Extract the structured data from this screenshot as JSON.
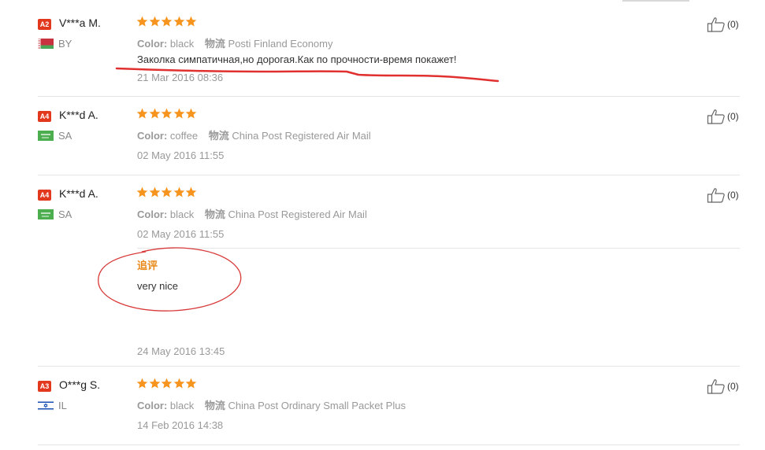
{
  "colors": {
    "badge": "#e2381e",
    "star": "#f7941e",
    "append_label": "#e8891a",
    "annotation": "#e03030"
  },
  "feedback": [
    {
      "level": "A2",
      "buyer": "V***a M.",
      "country": "BY",
      "flag_icon": "belarus-flag",
      "stars": 5,
      "color_label": "Color:",
      "color_value": "black",
      "shipping_label": "物流",
      "shipping_value": "Posti Finland Economy",
      "comment": "Заколка симпатичная,но дорогая.Как по прочности-время покажет!",
      "date": "21 Mar 2016 08:36",
      "helpful": "(0)"
    },
    {
      "level": "A4",
      "buyer": "K***d A.",
      "country": "SA",
      "flag_icon": "saudi-arabia-flag",
      "stars": 5,
      "color_label": "Color:",
      "color_value": "coffee",
      "shipping_label": "物流",
      "shipping_value": "China Post Registered Air Mail",
      "date": "02 May 2016 11:55",
      "helpful": "(0)"
    },
    {
      "level": "A4",
      "buyer": "K***d A.",
      "country": "SA",
      "flag_icon": "saudi-arabia-flag",
      "stars": 5,
      "color_label": "Color:",
      "color_value": "black",
      "shipping_label": "物流",
      "shipping_value": "China Post Registered Air Mail",
      "date": "02 May 2016 11:55",
      "append_label": "追评",
      "append_text": "very nice",
      "append_date": "24 May 2016 13:45",
      "helpful": "(0)"
    },
    {
      "level": "A3",
      "buyer": "O***g S.",
      "country": "IL",
      "flag_icon": "israel-flag",
      "stars": 5,
      "color_label": "Color:",
      "color_value": "black",
      "shipping_label": "物流",
      "shipping_value": "China Post Ordinary Small Packet Plus",
      "date": "14 Feb 2016 14:38",
      "helpful": "(0)"
    }
  ]
}
